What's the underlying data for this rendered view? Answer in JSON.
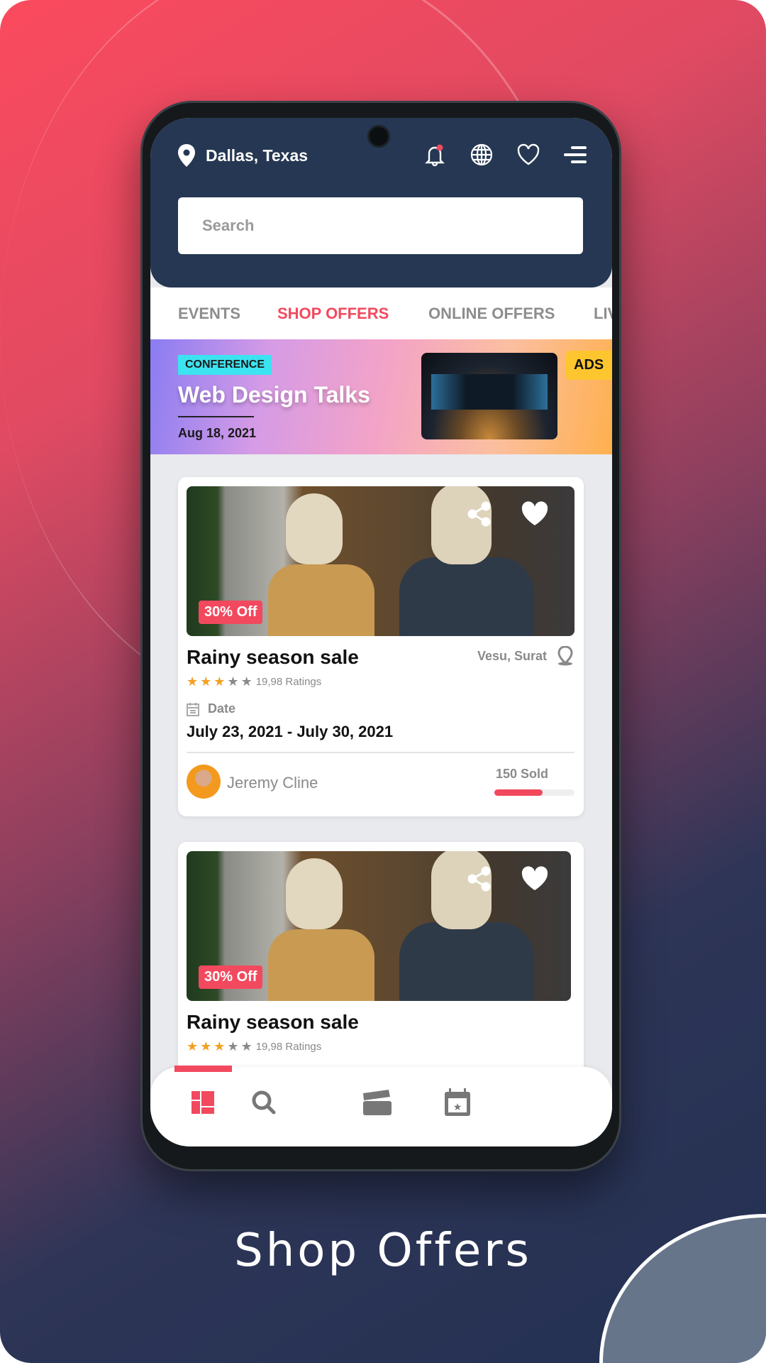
{
  "header": {
    "location": "Dallas, Texas",
    "search_placeholder": "Search",
    "icons": [
      "map-pin-icon",
      "bell-icon",
      "globe-icon",
      "heart-icon",
      "menu-icon"
    ]
  },
  "tabs": [
    {
      "label": "EVENTS"
    },
    {
      "label": "SHOP OFFERS",
      "active": true
    },
    {
      "label": "ONLINE OFFERS"
    },
    {
      "label": "LIV"
    }
  ],
  "banner": {
    "badge": "CONFERENCE",
    "title": "Web Design Talks",
    "date": "Aug 18, 2021",
    "ads_label": "ADS"
  },
  "cards": [
    {
      "discount": "30% Off",
      "title": "Rainy season sale",
      "location": "Vesu, Surat",
      "rating": 3,
      "rating_max": 5,
      "ratings_text": "19,98 Ratings",
      "date_label": "Date",
      "dates": "July 23, 2021 - July 30, 2021",
      "author": "Jeremy Cline",
      "sold": "150 Sold",
      "sold_progress": 0.6
    },
    {
      "discount": "30% Off",
      "title": "Rainy season sale",
      "rating": 3,
      "rating_max": 5,
      "ratings_text": "19,98 Ratings"
    }
  ],
  "bottom_nav": [
    {
      "icon": "dashboard-icon",
      "active": true
    },
    {
      "icon": "search-icon"
    },
    {
      "icon": "clapperboard-icon"
    },
    {
      "icon": "calendar-star-icon"
    }
  ],
  "caption": "Shop Offers",
  "colors": {
    "accent": "#f2495e",
    "header": "#253752",
    "ads": "#fdc62e",
    "badge": "#3ce3f0"
  }
}
